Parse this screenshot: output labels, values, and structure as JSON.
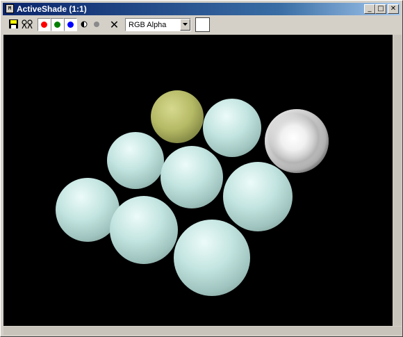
{
  "window": {
    "title": "ActiveShade (1:1)",
    "app_icon_text": "M",
    "minimize_symbol": "_",
    "maximize_symbol": "□",
    "close_symbol": "✕"
  },
  "toolbar": {
    "channel_select": {
      "selected": "RGB Alpha"
    },
    "clear_symbol": "✕",
    "channels": [
      {
        "name": "red",
        "color": "#ff0000"
      },
      {
        "name": "green",
        "color": "#008000"
      },
      {
        "name": "blue",
        "color": "#0000ff"
      }
    ],
    "swatch_color": "#ffffff"
  },
  "colors": {
    "titlebar": "#0a246a",
    "viewport_background": "#000000",
    "sphere_main": "#bfe0dc",
    "sphere_green": "#b4b964",
    "sphere_chrome": "#e8e8e8"
  }
}
